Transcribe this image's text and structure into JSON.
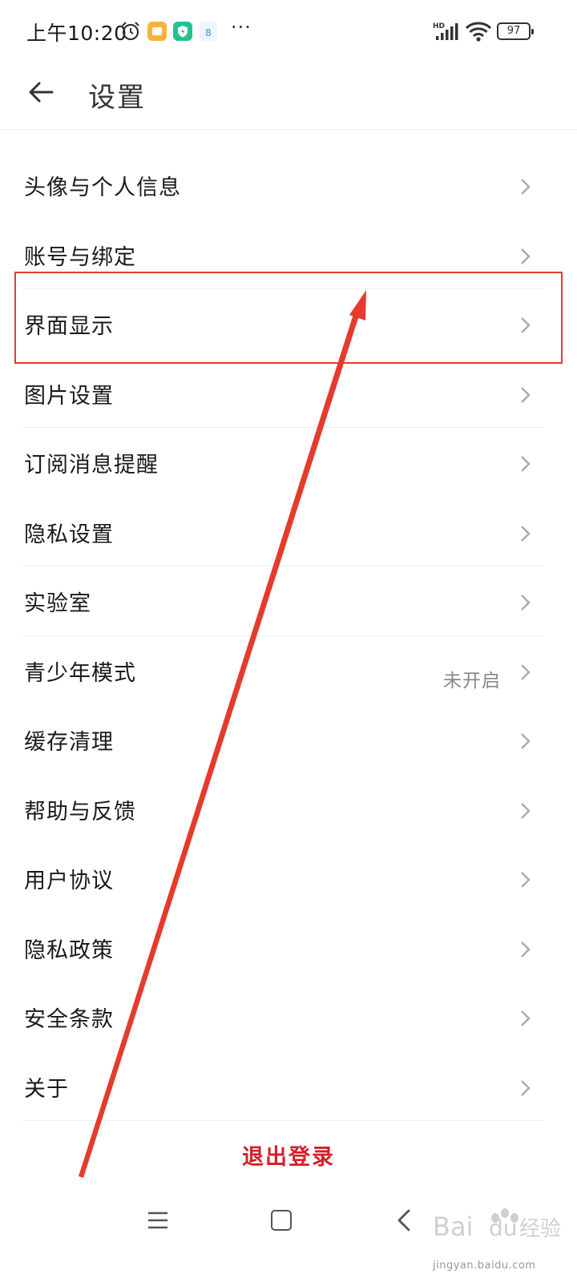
{
  "status_bar": {
    "time": "上午10:20",
    "app_icon_3_text": "8",
    "more": "···",
    "battery": "97"
  },
  "header": {
    "title": "设置"
  },
  "settings": {
    "items": [
      {
        "label": "头像与个人信息"
      },
      {
        "label": "账号与绑定"
      },
      {
        "label": "界面显示"
      },
      {
        "label": "图片设置"
      },
      {
        "label": "订阅消息提醒"
      },
      {
        "label": "隐私设置"
      },
      {
        "label": "实验室"
      },
      {
        "label": "青少年模式",
        "value": "未开启"
      },
      {
        "label": "缓存清理"
      },
      {
        "label": "帮助与反馈"
      },
      {
        "label": "用户协议"
      },
      {
        "label": "隐私政策"
      },
      {
        "label": "安全条款"
      },
      {
        "label": "关于"
      }
    ]
  },
  "logout_label": "退出登录",
  "watermark": {
    "text": "jingyan.baidu.com"
  },
  "colors": {
    "accent_red": "#d2202a",
    "highlight": "#e53b2c"
  }
}
